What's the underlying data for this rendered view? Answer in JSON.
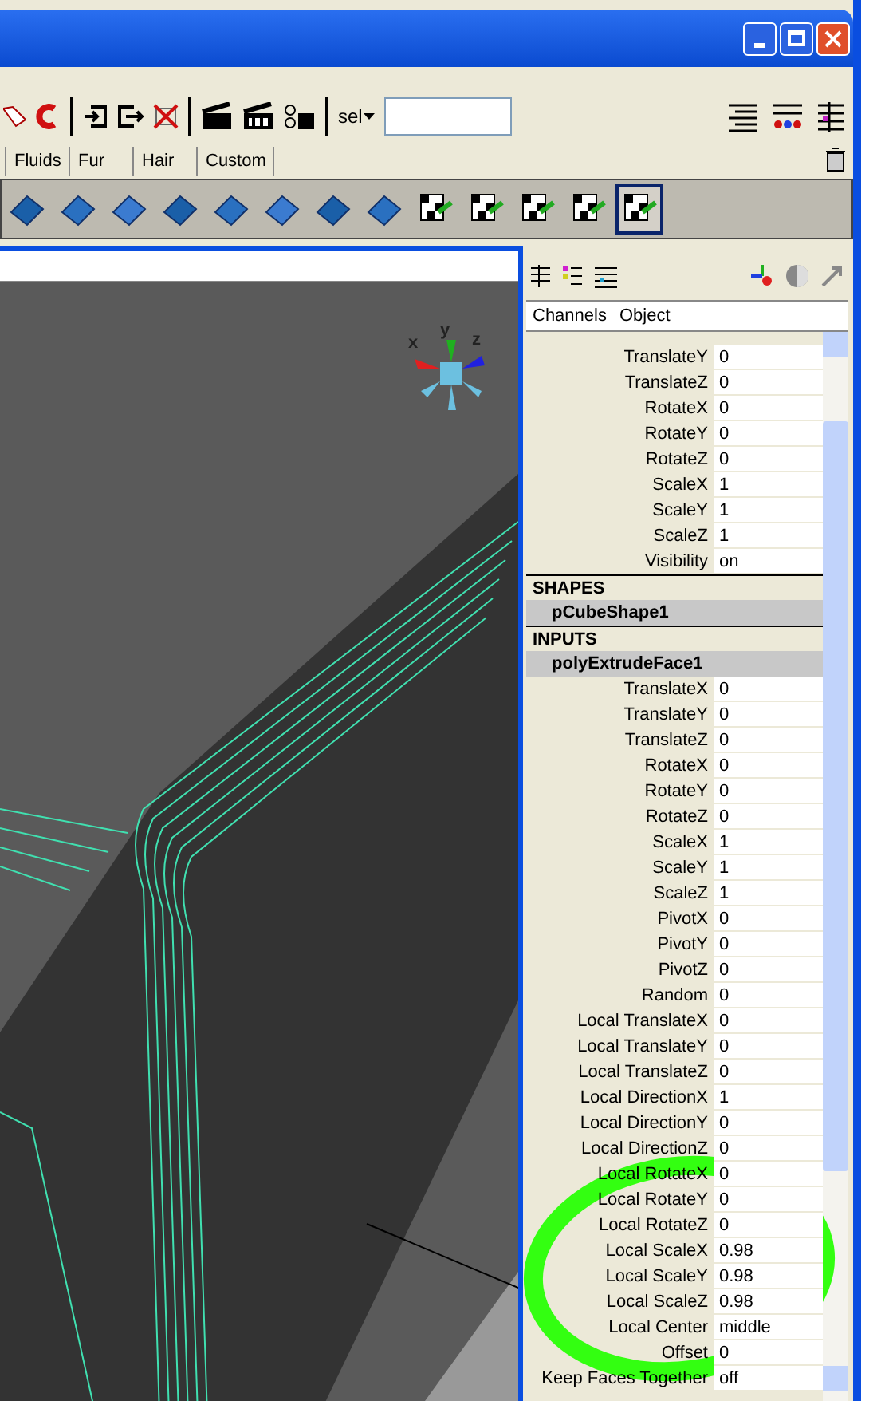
{
  "toolbar": {
    "selection_label": "sel"
  },
  "shelf_tabs": [
    {
      "label": "Fluids",
      "selected": false
    },
    {
      "label": "Fur",
      "selected": false
    },
    {
      "label": "Hair",
      "selected": false
    },
    {
      "label": "Custom",
      "selected": false
    }
  ],
  "shelf_icon_count_selected": [
    false,
    false,
    false,
    false,
    false,
    false,
    false,
    false,
    false,
    false,
    false,
    false,
    true
  ],
  "viewport": {
    "axis_labels": [
      "x",
      "y",
      "z"
    ]
  },
  "channel_box": {
    "menu": [
      "Channels",
      "Object"
    ],
    "transform_rows": [
      {
        "label": "TranslateY",
        "value": "0"
      },
      {
        "label": "TranslateZ",
        "value": "0"
      },
      {
        "label": "RotateX",
        "value": "0"
      },
      {
        "label": "RotateY",
        "value": "0"
      },
      {
        "label": "RotateZ",
        "value": "0"
      },
      {
        "label": "ScaleX",
        "value": "1"
      },
      {
        "label": "ScaleY",
        "value": "1"
      },
      {
        "label": "ScaleZ",
        "value": "1"
      },
      {
        "label": "Visibility",
        "value": "on"
      }
    ],
    "shapes_heading": "SHAPES",
    "shape_node": "pCubeShape1",
    "inputs_heading": "INPUTS",
    "input_node": "polyExtrudeFace1",
    "input_rows": [
      {
        "label": "TranslateX",
        "value": "0"
      },
      {
        "label": "TranslateY",
        "value": "0"
      },
      {
        "label": "TranslateZ",
        "value": "0"
      },
      {
        "label": "RotateX",
        "value": "0"
      },
      {
        "label": "RotateY",
        "value": "0"
      },
      {
        "label": "RotateZ",
        "value": "0"
      },
      {
        "label": "ScaleX",
        "value": "1"
      },
      {
        "label": "ScaleY",
        "value": "1"
      },
      {
        "label": "ScaleZ",
        "value": "1"
      },
      {
        "label": "PivotX",
        "value": "0"
      },
      {
        "label": "PivotY",
        "value": "0"
      },
      {
        "label": "PivotZ",
        "value": "0"
      },
      {
        "label": "Random",
        "value": "0"
      },
      {
        "label": "Local TranslateX",
        "value": "0"
      },
      {
        "label": "Local TranslateY",
        "value": "0"
      },
      {
        "label": "Local TranslateZ",
        "value": "0"
      },
      {
        "label": "Local DirectionX",
        "value": "1"
      },
      {
        "label": "Local DirectionY",
        "value": "0"
      },
      {
        "label": "Local DirectionZ",
        "value": "0"
      },
      {
        "label": "Local RotateX",
        "value": "0"
      },
      {
        "label": "Local RotateY",
        "value": "0"
      },
      {
        "label": "Local RotateZ",
        "value": "0"
      },
      {
        "label": "Local ScaleX",
        "value": "0.98"
      },
      {
        "label": "Local ScaleY",
        "value": "0.98"
      },
      {
        "label": "Local ScaleZ",
        "value": "0.98"
      },
      {
        "label": "Local Center",
        "value": "middle"
      },
      {
        "label": "Offset",
        "value": "0"
      },
      {
        "label": "Keep Faces Together",
        "value": "off"
      }
    ]
  }
}
